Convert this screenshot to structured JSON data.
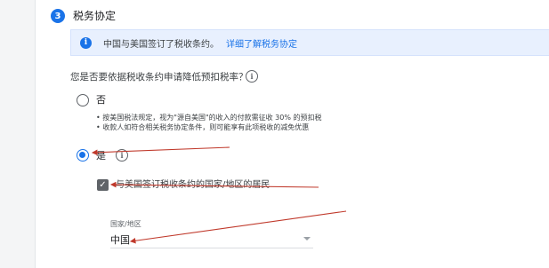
{
  "section": {
    "step_number": "3",
    "title": "税务协定"
  },
  "info": {
    "icon": "info-icon",
    "text": "中国与美国签订了税收条约。",
    "link": "详细了解税务协定"
  },
  "question": {
    "text": "您是否要依据税收条约申请降低预扣税率？",
    "help_icon": "help-circle-icon"
  },
  "options": {
    "no": {
      "label": "否",
      "selected": false,
      "bullets": [
        "按美国税法规定，视为\"源自美国\"的收入的付款需征收 30% 的预扣税",
        "收款人如符合相关税务协定条件，则可能享有此项税收的减免优惠"
      ]
    },
    "yes": {
      "label": "是",
      "selected": true
    }
  },
  "residency": {
    "checked": true,
    "label": "与美国签订税收条约的国家/地区的居民"
  },
  "country_field": {
    "label": "国家/地区",
    "value": "中国"
  },
  "colors": {
    "accent": "#1a73e8",
    "annotation_arrow": "#c0392b"
  }
}
